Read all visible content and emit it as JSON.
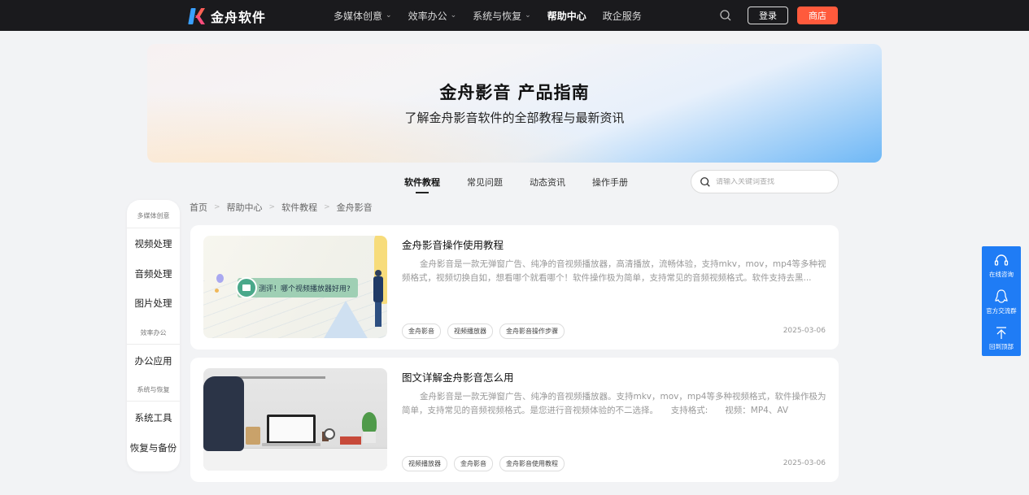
{
  "header": {
    "logo_text": "金舟软件",
    "nav": [
      {
        "label": "多媒体创意",
        "has_dropdown": true
      },
      {
        "label": "效率办公",
        "has_dropdown": true
      },
      {
        "label": "系统与恢复",
        "has_dropdown": true
      },
      {
        "label": "帮助中心",
        "has_dropdown": false,
        "active": true
      },
      {
        "label": "政企服务",
        "has_dropdown": false
      }
    ],
    "login_label": "登录",
    "store_label": "商店"
  },
  "banner": {
    "title": "金舟影音 产品指南",
    "subtitle": "了解金舟影音软件的全部教程与最新资讯"
  },
  "tabs": [
    {
      "label": "软件教程",
      "active": true
    },
    {
      "label": "常见问题"
    },
    {
      "label": "动态资讯"
    },
    {
      "label": "操作手册"
    }
  ],
  "search": {
    "placeholder": "请输入关键词查找"
  },
  "sidebar": {
    "groups": [
      {
        "label": "多媒体创意",
        "items": [
          "视频处理",
          "音频处理",
          "图片处理"
        ]
      },
      {
        "label": "效率办公",
        "items": [
          "办公应用"
        ]
      },
      {
        "label": "系统与恢复",
        "items": [
          "系统工具",
          "恢复与备份"
        ]
      }
    ]
  },
  "breadcrumb": [
    "首页",
    "帮助中心",
    "软件教程",
    "金舟影音"
  ],
  "articles": [
    {
      "title": "金舟影音操作使用教程",
      "description": "金舟影音是一款无弹窗广告、纯净的音视频播放器，高清播放，流畅体验，支持mkv，mov，mp4等多种视频格式，视频切换自如，想看哪个就看哪个！软件操作极为简单，支持常见的音频视频格式。软件支持去黑...",
      "thumb_text": "测评！哪个视频播放器好用?",
      "tags": [
        "金舟影音",
        "视频播放器",
        "金舟影音操作步骤"
      ],
      "date": "2025-03-06"
    },
    {
      "title": "图文详解金舟影音怎么用",
      "description": "金舟影音是一款无弹窗广告、纯净的音视频播放器。支持mkv，mov，mp4等多种视频格式，软件操作极为简单，支持常见的音频视频格式。是您进行音视频体验的不二选择。　　支持格式:　　视频：MP4、AV",
      "tags": [
        "视频播放器",
        "金舟影音",
        "金舟影音使用教程"
      ],
      "date": "2025-03-06"
    }
  ],
  "float_bar": [
    {
      "label": "在线咨询",
      "icon": "headset-icon"
    },
    {
      "label": "官方交流群",
      "icon": "penguin-icon"
    },
    {
      "label": "回到顶部",
      "icon": "arrow-up-icon"
    }
  ],
  "colors": {
    "topbar": "#1a1a1d",
    "store_button": "#ff5a3c",
    "float_bar": "#1f7cf5",
    "page_bg": "#f2f3f5"
  }
}
